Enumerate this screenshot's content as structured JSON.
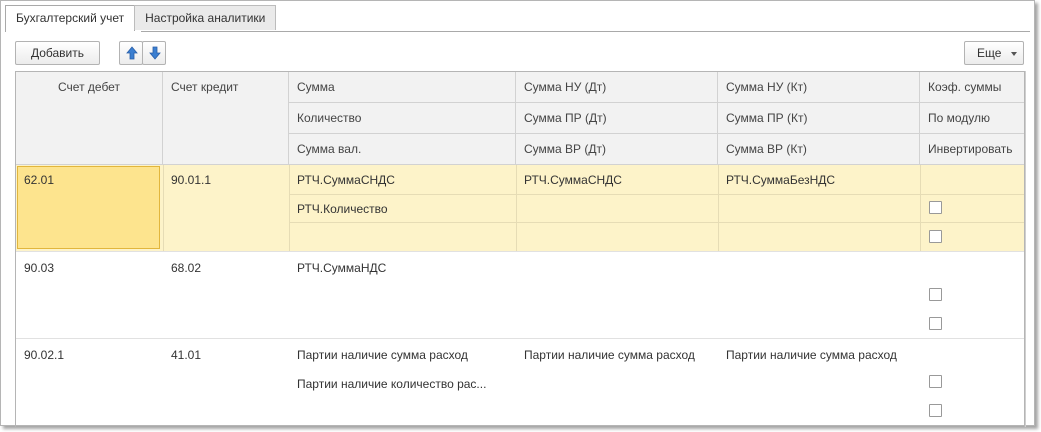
{
  "tabs": [
    {
      "label": "Бухгалтерский учет",
      "active": true
    },
    {
      "label": "Настройка аналитики",
      "active": false
    }
  ],
  "toolbar": {
    "add_label": "Добавить",
    "up_icon": "arrow-up-icon",
    "down_icon": "arrow-down-icon",
    "more_label": "Еще"
  },
  "columns": {
    "debit": "Счет дебет",
    "credit": "Счет кредит",
    "sum": [
      "Сумма",
      "Количество",
      "Сумма вал."
    ],
    "nu_dt": [
      "Сумма НУ (Дт)",
      "Сумма ПР (Дт)",
      "Сумма ВР (Дт)"
    ],
    "nu_kt": [
      "Сумма НУ (Кт)",
      "Сумма ПР (Кт)",
      "Сумма ВР (Кт)"
    ],
    "coef": [
      "Коэф. суммы",
      "По модулю",
      "Инвертировать"
    ]
  },
  "rows": [
    {
      "debit": "62.01",
      "credit": "90.01.1",
      "sum": [
        "РТЧ.СуммаСНДС",
        "РТЧ.Количество",
        ""
      ],
      "nu_dt": [
        "РТЧ.СуммаСНДС",
        "",
        ""
      ],
      "nu_kt": [
        "РТЧ.СуммаБезНДС",
        "",
        ""
      ],
      "by_module": false,
      "invert": false,
      "selected": true
    },
    {
      "debit": "90.03",
      "credit": "68.02",
      "sum": [
        "РТЧ.СуммаНДС",
        "",
        ""
      ],
      "nu_dt": [
        "",
        "",
        ""
      ],
      "nu_kt": [
        "",
        "",
        ""
      ],
      "by_module": false,
      "invert": false,
      "selected": false
    },
    {
      "debit": "90.02.1",
      "credit": "41.01",
      "sum": [
        "Партии наличие сумма расход",
        "Партии наличие количество рас...",
        ""
      ],
      "nu_dt": [
        "Партии наличие сумма расход",
        "",
        ""
      ],
      "nu_kt": [
        "Партии наличие сумма расход",
        "",
        ""
      ],
      "by_module": false,
      "invert": false,
      "selected": false
    }
  ],
  "colors": {
    "selected_row": "#fdf3c9",
    "active_cell": "#fde48e",
    "arrow_blue": "#3b7fd1"
  }
}
